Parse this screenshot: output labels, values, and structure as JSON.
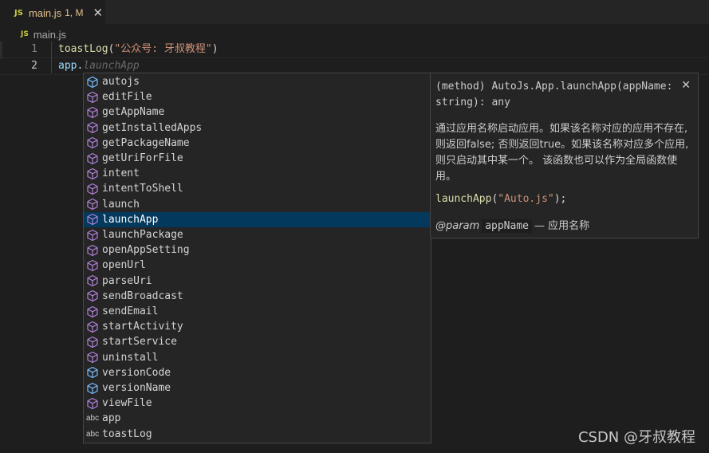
{
  "tab": {
    "badge": "JS",
    "title": "main.js",
    "status": "1, M",
    "close": "✕"
  },
  "breadcrumb": {
    "badge": "JS",
    "file": "main.js"
  },
  "editor": {
    "lines": [
      {
        "number": "1",
        "fn": "toastLog",
        "open": "(",
        "str": "\"公众号: 牙叔教程\"",
        "close": ")"
      },
      {
        "number": "2",
        "obj": "app",
        "dot": ".",
        "ghost": "launchApp"
      }
    ]
  },
  "suggestions": [
    {
      "label": "autojs",
      "icon": "property-icon"
    },
    {
      "label": "editFile",
      "icon": "method-icon"
    },
    {
      "label": "getAppName",
      "icon": "method-icon"
    },
    {
      "label": "getInstalledApps",
      "icon": "method-icon"
    },
    {
      "label": "getPackageName",
      "icon": "method-icon"
    },
    {
      "label": "getUriForFile",
      "icon": "method-icon"
    },
    {
      "label": "intent",
      "icon": "method-icon"
    },
    {
      "label": "intentToShell",
      "icon": "method-icon"
    },
    {
      "label": "launch",
      "icon": "method-icon"
    },
    {
      "label": "launchApp",
      "icon": "method-icon",
      "selected": true
    },
    {
      "label": "launchPackage",
      "icon": "method-icon"
    },
    {
      "label": "openAppSetting",
      "icon": "method-icon"
    },
    {
      "label": "openUrl",
      "icon": "method-icon"
    },
    {
      "label": "parseUri",
      "icon": "method-icon"
    },
    {
      "label": "sendBroadcast",
      "icon": "method-icon"
    },
    {
      "label": "sendEmail",
      "icon": "method-icon"
    },
    {
      "label": "startActivity",
      "icon": "method-icon"
    },
    {
      "label": "startService",
      "icon": "method-icon"
    },
    {
      "label": "uninstall",
      "icon": "method-icon"
    },
    {
      "label": "versionCode",
      "icon": "property-icon"
    },
    {
      "label": "versionName",
      "icon": "property-icon"
    },
    {
      "label": "viewFile",
      "icon": "method-icon"
    },
    {
      "label": "app",
      "icon": "abc-icon",
      "abc": "abc"
    },
    {
      "label": "toastLog",
      "icon": "abc-icon",
      "abc": "abc"
    }
  ],
  "details": {
    "signature": "(method) AutoJs.App.launchApp(appName: string): any",
    "close": "✕",
    "description": "通过应用名称启动应用。如果该名称对应的应用不存在, 则返回false; 否则返回true。如果该名称对应多个应用, 则只启动其中某一个。 该函数也可以作为全局函数使用。",
    "example_fn": "launchApp",
    "example_open": "(",
    "example_str": "\"Auto.js\"",
    "example_close": ");",
    "param_tag": "@param",
    "param_name": "appName",
    "param_desc": "— 应用名称"
  },
  "watermark": "CSDN @牙叔教程",
  "colors": {
    "method_icon": "#b180d7",
    "property_icon": "#75beff",
    "selection": "#04395e"
  }
}
